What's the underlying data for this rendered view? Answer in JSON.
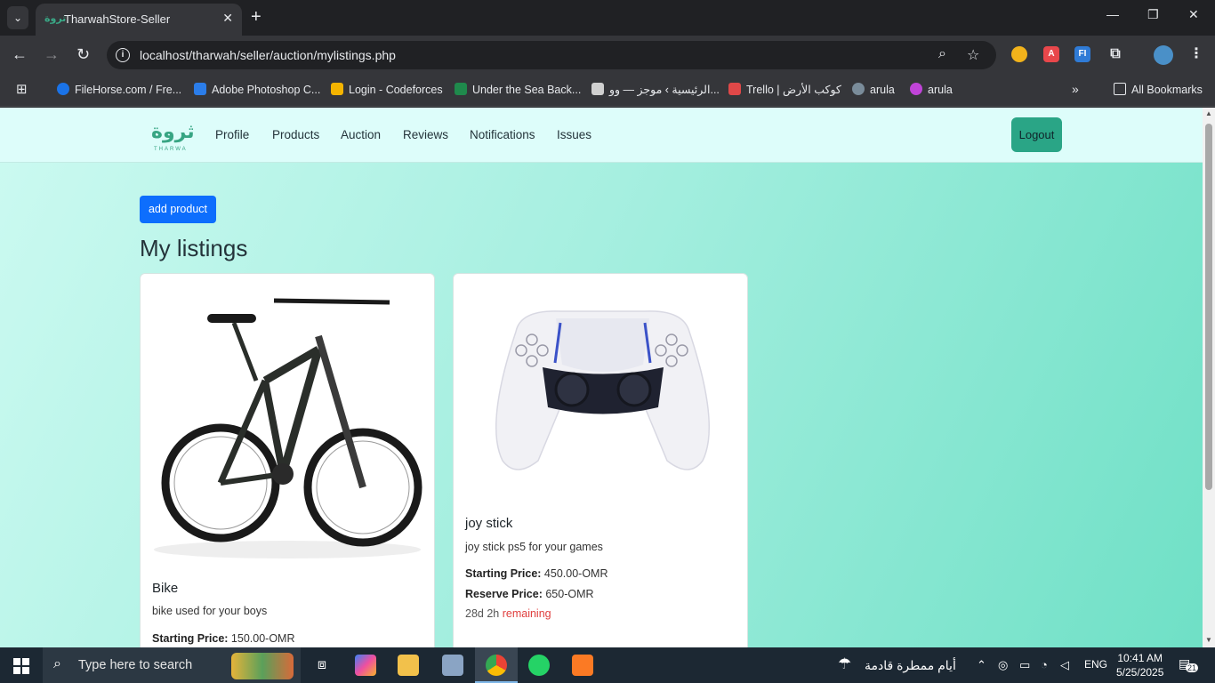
{
  "browser": {
    "tab_title": "TharwahStore-Seller",
    "url": "localhost/tharwah/seller/auction/mylistings.php",
    "bookmarks": [
      {
        "label": "FileHorse.com / Fre...",
        "color": "#1a73e8"
      },
      {
        "label": "Adobe Photoshop C...",
        "color": "#2b7de9"
      },
      {
        "label": "Login - Codeforces",
        "color": "#f4b400"
      },
      {
        "label": "Under the Sea Back...",
        "color": "#1f8a4c"
      },
      {
        "label": "الرئيسية › موجز — وو...",
        "color": "#d0d0d0"
      },
      {
        "label": "Trello | كوكب الأرض",
        "color": "#e04848"
      },
      {
        "label": "arula",
        "color": "#7a8c9a"
      },
      {
        "label": "arula",
        "color": "#c044d8"
      }
    ],
    "all_bookmarks": "All Bookmarks"
  },
  "site": {
    "logo_text": "ثروة",
    "logo_sub": "THARWA",
    "nav": [
      "Profile",
      "Products",
      "Auction",
      "Reviews",
      "Notifications",
      "Issues"
    ],
    "logout": "Logout",
    "accent": "#2aa586"
  },
  "page": {
    "add_button": "add product",
    "heading": "My listings"
  },
  "cards": [
    {
      "title": "Bike",
      "desc": "bike used for your boys",
      "starting_label": "Starting Price:",
      "starting_value": "150.00-OMR"
    },
    {
      "title": "joy stick",
      "desc": "joy stick ps5 for your games",
      "starting_label": "Starting Price:",
      "starting_value": "450.00-OMR",
      "reserve_label": "Reserve Price:",
      "reserve_value": "650-OMR",
      "remaining_time": "28d 2h",
      "remaining_word": "remaining"
    }
  ],
  "taskbar": {
    "search_placeholder": "Type here to search",
    "weather": "أيام ممطرة قادمة",
    "lang": "ENG",
    "time": "10:41 AM",
    "date": "5/25/2025",
    "notif_count": "21"
  }
}
